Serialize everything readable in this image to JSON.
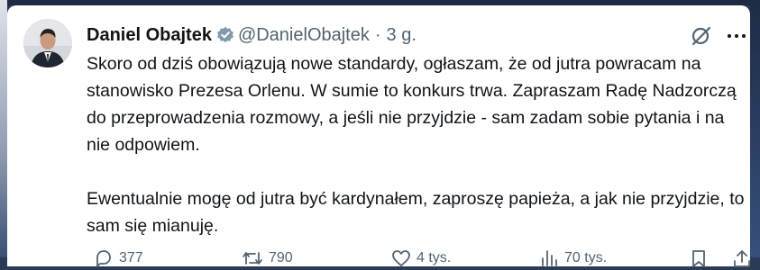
{
  "tweet": {
    "author_name": "Daniel Obajtek",
    "handle": "@DanielObajtek",
    "separator": "·",
    "time": "3 g.",
    "paragraphs": [
      "Skoro od dziś obowiązują nowe standardy, ogłaszam, że od jutra powracam na stanowisko Prezesa Orlenu. W sumie to konkurs trwa. Zapraszam Radę Nadzorczą do przeprowadzenia rozmowy, a jeśli nie przyjdzie - sam zadam sobie pytania i na nie odpowiem.",
      "Ewentualnie mogę od jutra być kardynałem, zaproszę papieża, a jak nie przyjdzie, to sam się mianuję."
    ],
    "stats": {
      "replies": "377",
      "reposts": "790",
      "likes": "4 tys.",
      "views": "70 tys."
    }
  },
  "icons": {
    "verified": "verified-badge-icon",
    "grok": "grok-icon",
    "more": "more-icon",
    "reply": "reply-icon",
    "repost": "repost-icon",
    "like": "like-icon",
    "views": "views-icon",
    "bookmark": "bookmark-icon",
    "share": "share-icon"
  },
  "colors": {
    "text": "#0f1419",
    "secondary": "#536471",
    "verified": "#829aab",
    "background": "#ffffff"
  }
}
